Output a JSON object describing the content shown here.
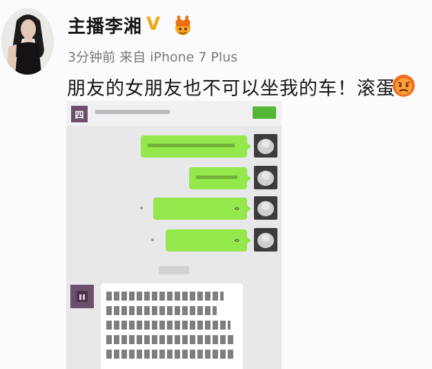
{
  "post": {
    "username": "主播李湘",
    "verified_mark": "V",
    "crown_icon": "crown-icon",
    "time": "3分钟前",
    "source_prefix": "来自",
    "source_device": "iPhone 7 Plus",
    "text": "朋友的女朋友也不可以坐我的车！滚蛋！",
    "emoji_icon": "angry-face-icon"
  },
  "screenshot": {
    "header_icon": "四",
    "messages": [
      {
        "side": "me",
        "has_voice_mark": false
      },
      {
        "side": "me",
        "has_voice_mark": false
      },
      {
        "side": "me",
        "has_voice_mark": true
      },
      {
        "side": "me",
        "has_voice_mark": false
      }
    ]
  },
  "colors": {
    "verified": "#f2a70a",
    "bubble_green": "#95e84c",
    "chat_bg": "#e8e8ea"
  }
}
